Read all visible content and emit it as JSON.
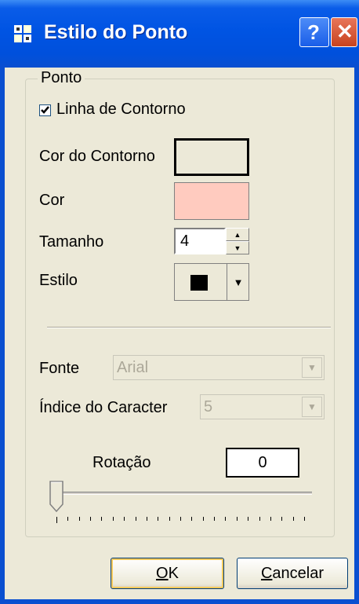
{
  "window": {
    "title": "Estilo do Ponto",
    "help_label": "?",
    "close_label": "✕"
  },
  "group": {
    "title": "Ponto",
    "outline_checkbox": {
      "label": "Linha de Contorno",
      "checked": true
    },
    "outline_color": {
      "label": "Cor do Contorno",
      "color": "#ece9d8"
    },
    "fill_color": {
      "label": "Cor",
      "color": "#ffcbbf"
    },
    "size": {
      "label": "Tamanho",
      "value": "4"
    },
    "style": {
      "label": "Estilo"
    },
    "font": {
      "label": "Fonte",
      "value": "Arial",
      "disabled": true
    },
    "char_index": {
      "label": "Índice do Caracter",
      "value": "5",
      "disabled": true
    },
    "rotation": {
      "label": "Rotação",
      "value": "0",
      "slider_fraction": 0
    }
  },
  "buttons": {
    "ok": {
      "mnemonic": "O",
      "rest": "K"
    },
    "cancel": {
      "mnemonic": "C",
      "rest": "ancelar"
    }
  }
}
